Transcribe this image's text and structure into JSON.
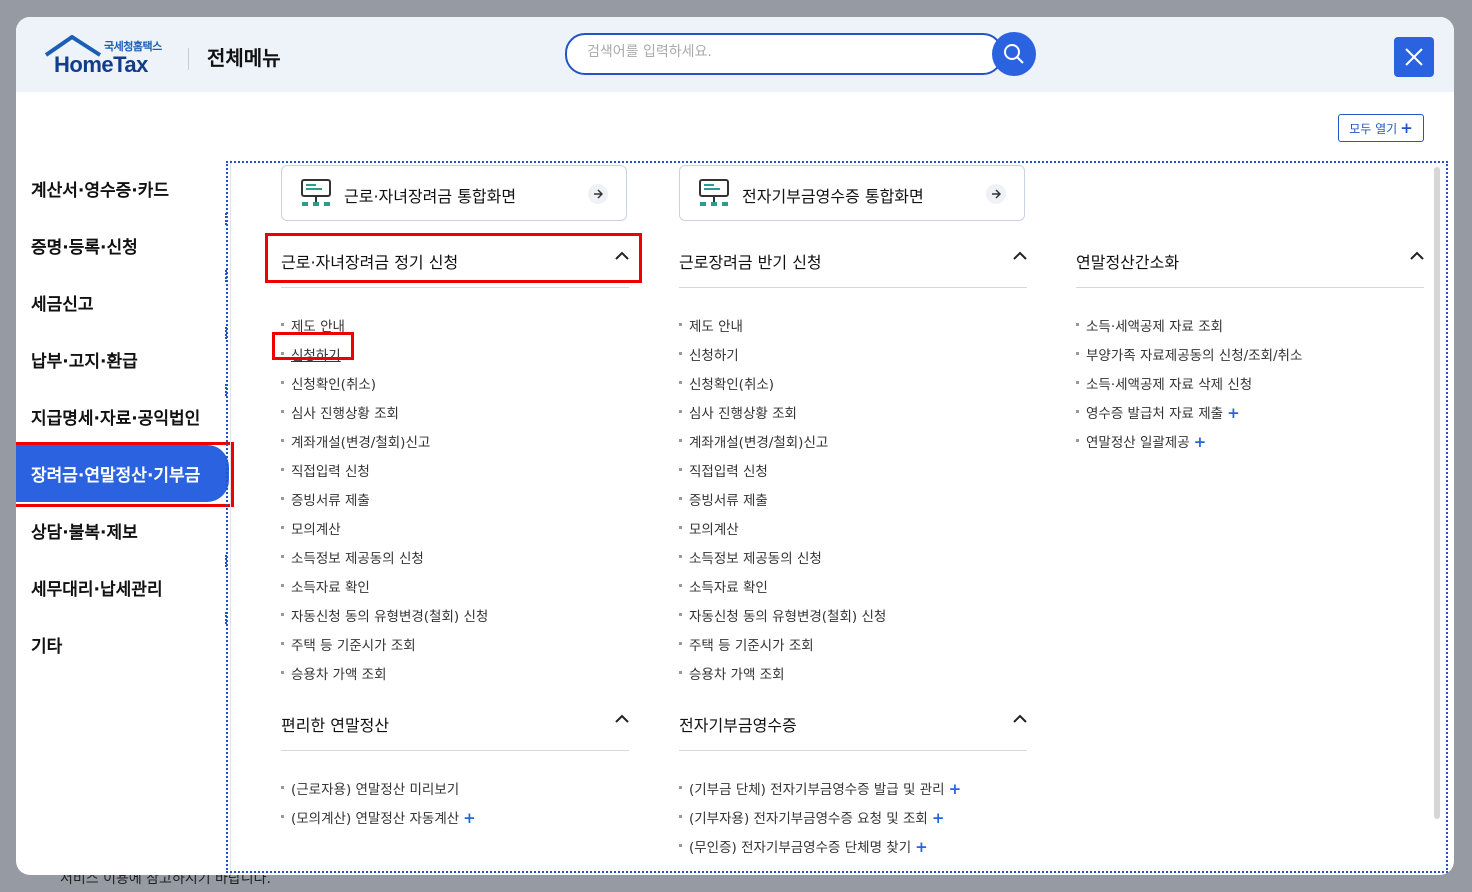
{
  "background": {
    "footer_text": "서비스 이용에 참고하시기 바랍니다."
  },
  "header": {
    "logo_small": "국세청홈택스",
    "logo_main": "HomeTax",
    "title": "전체메뉴",
    "search_placeholder": "검색어를 입력하세요.",
    "open_all_label": "모두 열기"
  },
  "left_nav": [
    {
      "label": "계산서·영수증·카드"
    },
    {
      "label": "증명·등록·신청"
    },
    {
      "label": "세금신고"
    },
    {
      "label": "납부·고지·환급"
    },
    {
      "label": "지급명세·자료·공익법인"
    },
    {
      "label": "장려금·연말정산·기부금",
      "active": true
    },
    {
      "label": "상담·불복·제보"
    },
    {
      "label": "세무대리·납세관리"
    },
    {
      "label": "기타"
    }
  ],
  "quick_links": [
    {
      "label": "근로·자녀장려금 통합화면"
    },
    {
      "label": "전자기부금영수증 통합화면"
    }
  ],
  "sections": [
    {
      "title": "근로·자녀장려금 정기 신청",
      "items": [
        "제도 안내",
        "신청하기",
        "신청확인(취소)",
        "심사 진행상황 조회",
        "계좌개설(변경/철회)신고",
        "직접입력 신청",
        "증빙서류 제출",
        "모의계산",
        "소득정보 제공동의 신청",
        "소득자료 확인",
        "자동신청 동의 유형변경(철회) 신청",
        "주택 등 기준시가 조회",
        "승용차 가액 조회"
      ]
    },
    {
      "title": "근로장려금 반기 신청",
      "items": [
        "제도 안내",
        "신청하기",
        "신청확인(취소)",
        "심사 진행상황 조회",
        "계좌개설(변경/철회)신고",
        "직접입력 신청",
        "증빙서류 제출",
        "모의계산",
        "소득정보 제공동의 신청",
        "소득자료 확인",
        "자동신청 동의 유형변경(철회) 신청",
        "주택 등 기준시가 조회",
        "승용차 가액 조회"
      ]
    },
    {
      "title": "연말정산간소화",
      "items": [
        "소득·세액공제 자료 조회",
        "부양가족 자료제공동의 신청/조회/취소",
        "소득·세액공제 자료 삭제 신청",
        "영수증 발급처 자료 제출",
        "연말정산 일괄제공"
      ]
    },
    {
      "title": "편리한 연말정산",
      "items": [
        "(근로자용) 연말정산 미리보기",
        "(모의계산) 연말정산 자동계산"
      ]
    },
    {
      "title": "전자기부금영수증",
      "items": [
        "(기부금 단체) 전자기부금영수증 발급 및 관리",
        "(기부자용) 전자기부금영수증 요청 및 조회",
        "(무인증) 전자기부금영수증 단체명 찾기"
      ]
    }
  ]
}
